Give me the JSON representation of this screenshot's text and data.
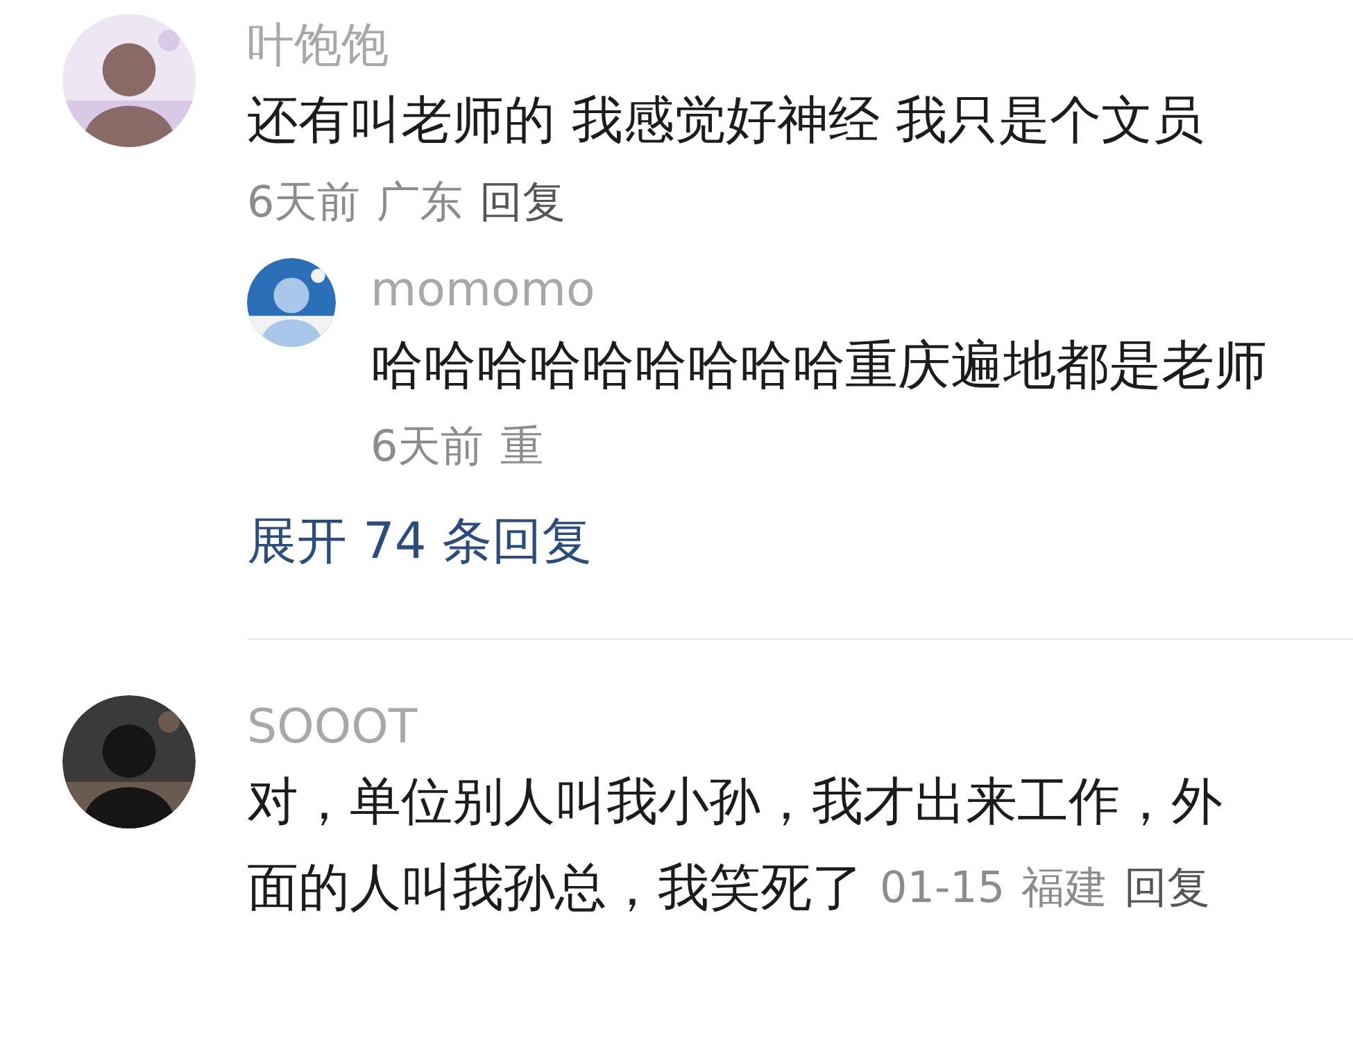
{
  "comments": [
    {
      "author": "叶饱饱",
      "avatar": {
        "kind": "picture"
      },
      "text": "还有叫老师的 我感觉好神经 我只是个文员",
      "time": "6天前",
      "location": "广东",
      "reply": "回复",
      "replies": [
        {
          "author": "momomo",
          "avatar": {
            "kind": "picture"
          },
          "text": "哈哈哈哈哈哈哈哈哈重庆遍地都是老师",
          "time": "6天前",
          "location": "重"
        }
      ],
      "expand": "展开 74 条回复"
    },
    {
      "author": "SOOOT",
      "avatar": {
        "kind": "picture"
      },
      "text_lines": [
        "对，单位别人叫我小孙，我才出来工作，外",
        "面的人叫我孙总，我笑死了"
      ],
      "time": "01-15",
      "location": "福建",
      "reply": "回复"
    }
  ]
}
